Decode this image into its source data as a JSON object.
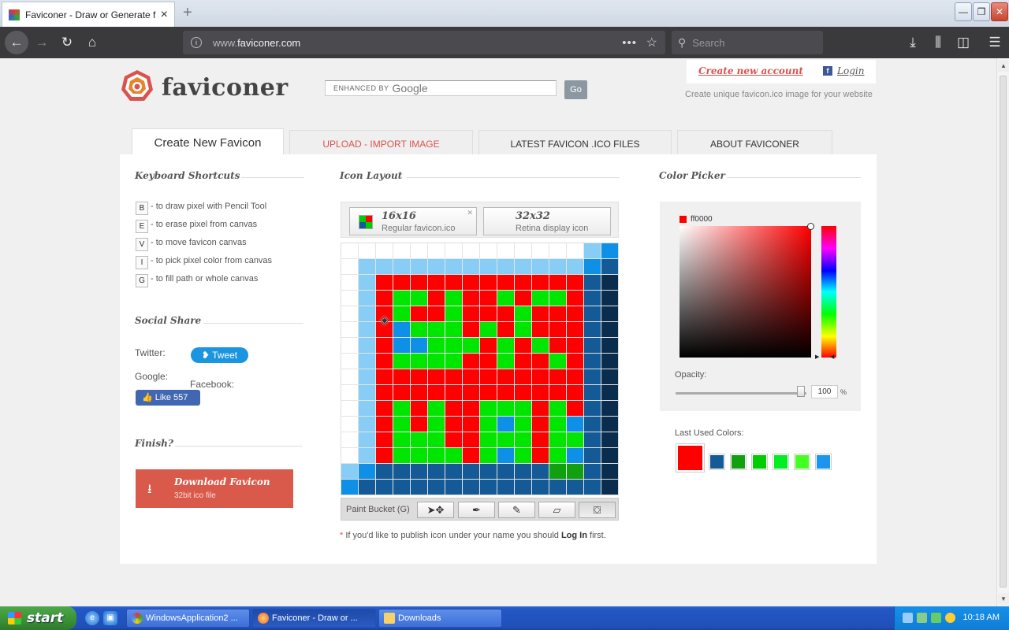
{
  "browser": {
    "tab_title": "Faviconer - Draw or Generate favi",
    "url_prefix": "www.",
    "url_domain": "faviconer.com",
    "search_placeholder": "Search"
  },
  "site": {
    "logo_text": "faviconer",
    "search_enhanced": "ENHANCED BY",
    "search_google": "Google",
    "go_label": "Go",
    "create_account": "Create new account",
    "login": "Login",
    "tagline": "Create unique favicon.ico image for your website"
  },
  "tabs": [
    {
      "label": "Create New Favicon"
    },
    {
      "label": "UPLOAD - IMPORT IMAGE"
    },
    {
      "label": "LATEST FAVICON .ICO FILES"
    },
    {
      "label": "ABOUT FAVICONER"
    }
  ],
  "shortcuts": {
    "heading": "Keyboard Shortcuts",
    "items": [
      {
        "key": "B",
        "desc": "- to draw pixel with Pencil Tool"
      },
      {
        "key": "E",
        "desc": "- to erase pixel from canvas"
      },
      {
        "key": "V",
        "desc": "- to move favicon canvas"
      },
      {
        "key": "I",
        "desc": "- to pick pixel color from canvas"
      },
      {
        "key": "G",
        "desc": "- to fill path or whole canvas"
      }
    ]
  },
  "social": {
    "heading": "Social Share",
    "twitter_label": "Twitter:",
    "tweet": "Tweet",
    "google_label": "Google:",
    "facebook_label": "Facebook:",
    "like": "Like 557"
  },
  "finish": {
    "heading": "Finish?",
    "download_title": "Download Favicon",
    "download_sub": "32bit ico file"
  },
  "icon_layout": {
    "heading": "Icon Layout",
    "opt16_title": "16x16",
    "opt16_sub": "Regular favicon.ico",
    "opt32_title": "32x32",
    "opt32_sub": "Retina display icon",
    "active_tool_label": "Paint Bucket (G)",
    "publish_pre": "If you'd like to publish icon under your name you should",
    "publish_link": "Log In",
    "publish_post": "first.",
    "palette": {
      "W": "#ffffff",
      "L": "#87cdf5",
      "B": "#0d90e6",
      "N": "#135a96",
      "D": "#0a2d4d",
      "R": "#ff0000",
      "G": "#00e600",
      "K": "#10a010"
    },
    "pixels": [
      "WWWWWWWWWWWWWWLB",
      "WLLLLLLLLLLLLLBN",
      "WLRRRRRRRRRRRRND",
      "WLRGGRGRRGRGGRND",
      "WLRGRRGRRRGRRRND",
      "WLRBGGGRGRGRRRND",
      "WLRBBGGGRGRGRRND",
      "WLRGGGGRRGRRGRND",
      "WLRRRRRRRRRRRRND",
      "WLRRRRRRRRRRRRND",
      "WLRGRGRRGGGRGRND",
      "WLRGRGRRGBGRGBND",
      "WLRGGGRRGGGRGGND",
      "WLRGGGGRGBGRGBND",
      "LBNNNNNNNNNNKKND",
      "BNNNNNNNNNNNNNND"
    ]
  },
  "picker": {
    "heading": "Color Picker",
    "hex": "ff0000",
    "opacity_label": "Opacity:",
    "opacity_value": "100",
    "opacity_unit": "%",
    "last_used_label": "Last Used Colors:",
    "big_color": "#ff0000",
    "last_used": [
      "#135a96",
      "#10a010",
      "#00cc00",
      "#00ee22",
      "#44ff22",
      "#1a96ee"
    ]
  },
  "taskbar": {
    "start": "start",
    "tasks": [
      {
        "label": "WindowsApplication2 ..."
      },
      {
        "label": "Faviconer - Draw or ..."
      },
      {
        "label": "Downloads"
      }
    ],
    "clock": "10:18 AM"
  }
}
